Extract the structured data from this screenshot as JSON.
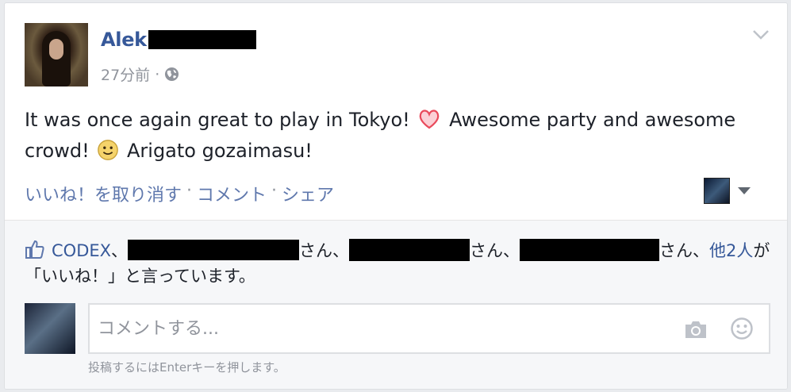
{
  "post": {
    "author_name": "Alek",
    "timestamp": "27分前",
    "dot": "·",
    "text_part1": "It was once again great to play in Tokyo!",
    "text_part2": "Awesome party and awesome crowd!",
    "text_part3": "Arigato gozaimasu!",
    "menu_icon": "chevron-down-icon",
    "privacy_icon": "globe-icon"
  },
  "actions": {
    "like": "いいね！を取り消す",
    "comment": "コメント",
    "share": "シェア",
    "separator": "·"
  },
  "likes": {
    "first": "CODEX",
    "comma": "、",
    "san1": "さん、",
    "san2": "さん、",
    "san3": "さん、",
    "others": "他2人",
    "tail": "が「いいね！」と言っています。"
  },
  "comment": {
    "placeholder": "コメントする...",
    "hint": "投稿するにはEnterキーを押します。"
  },
  "colors": {
    "link": "#365899",
    "muted": "#90949c",
    "like_blue": "#5f78ad",
    "heart": "#e94a5b"
  }
}
